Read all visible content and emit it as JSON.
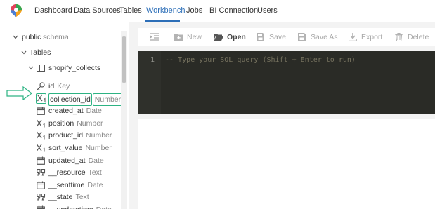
{
  "nav": {
    "logo_icon": "metabase-like-logo-icon",
    "items": [
      {
        "label": "Dashboard",
        "active": false
      },
      {
        "label": "Data Sources",
        "active": false
      },
      {
        "label": "Tables",
        "active": false
      },
      {
        "label": "Workbench",
        "active": true
      },
      {
        "label": "Jobs",
        "active": false
      },
      {
        "label": "BI Connection",
        "active": false
      },
      {
        "label": "Users",
        "active": false
      }
    ],
    "accent_color": "#2d6fb8"
  },
  "tree": {
    "schema": {
      "name": "public",
      "suffix": "schema"
    },
    "tables_label": "Tables",
    "table": {
      "name": "shopify_collects"
    },
    "columns": [
      {
        "name": "id",
        "type": "Key",
        "icon": "key-icon"
      },
      {
        "name": "collection_id",
        "type": "Number",
        "icon": "number-icon",
        "highlighted": true
      },
      {
        "name": "created_at",
        "type": "Date",
        "icon": "calendar-icon"
      },
      {
        "name": "position",
        "type": "Number",
        "icon": "number-icon"
      },
      {
        "name": "product_id",
        "type": "Number",
        "icon": "number-icon"
      },
      {
        "name": "sort_value",
        "type": "Number",
        "icon": "number-icon"
      },
      {
        "name": "updated_at",
        "type": "Date",
        "icon": "calendar-icon"
      },
      {
        "name": "__resource",
        "type": "Text",
        "icon": "quote-icon"
      },
      {
        "name": "__senttime",
        "type": "Date",
        "icon": "calendar-icon"
      },
      {
        "name": "__state",
        "type": "Text",
        "icon": "quote-icon"
      },
      {
        "name": "__updatetime",
        "type": "Date",
        "icon": "calendar-icon"
      }
    ],
    "highlight_color": "#2db383"
  },
  "toolbar": {
    "items": [
      {
        "label": "",
        "icon": "indent-icon",
        "enabled": false
      },
      {
        "label": "New",
        "icon": "new-folder-icon",
        "enabled": false
      },
      {
        "label": "Open",
        "icon": "open-folder-icon",
        "enabled": true
      },
      {
        "label": "Save",
        "icon": "save-icon",
        "enabled": false
      },
      {
        "label": "Save As",
        "icon": "save-as-icon",
        "enabled": false
      },
      {
        "label": "Export",
        "icon": "export-icon",
        "enabled": false
      },
      {
        "label": "Delete",
        "icon": "trash-icon",
        "enabled": false
      }
    ]
  },
  "editor": {
    "line_number": "1",
    "placeholder": "-- Type your SQL query (Shift + Enter to run)",
    "background": "#2a2b26"
  }
}
